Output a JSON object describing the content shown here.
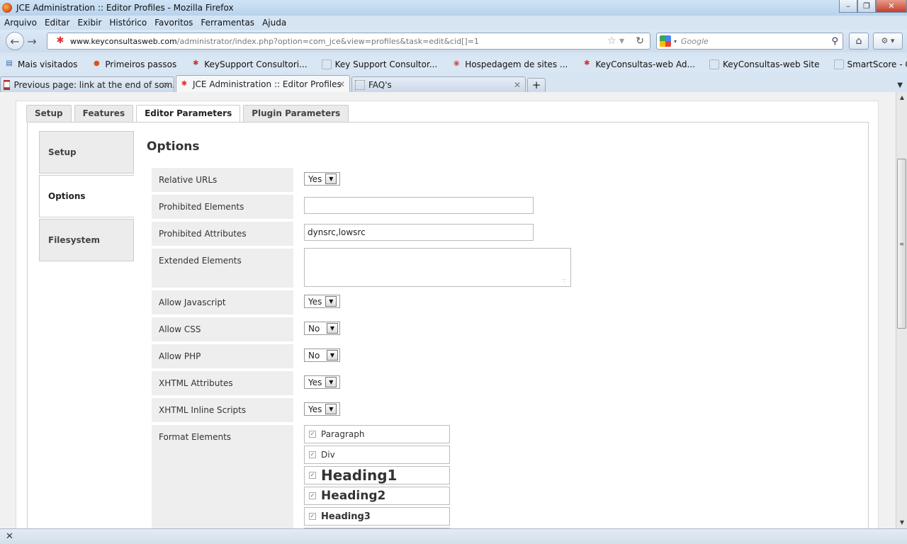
{
  "window": {
    "title": "JCE Administration :: Editor Profiles - Mozilla Firefox"
  },
  "menu": [
    "Arquivo",
    "Editar",
    "Exibir",
    "Histórico",
    "Favoritos",
    "Ferramentas",
    "Ajuda"
  ],
  "nav": {
    "url_domain": "www.keyconsultasweb.com",
    "url_path": "/administrator/index.php?option=com_jce&view=profiles&task=edit&cid[]=1",
    "search_placeholder": "Google"
  },
  "bookmarks": [
    "Mais visitados",
    "Primeiros passos",
    "KeySupport Consultori...",
    "Key Support Consultor...",
    "Hospedagem de sites ...",
    "KeyConsultas-web Ad...",
    "KeyConsultas-web Site",
    "SmartScore - Consulta..."
  ],
  "browser_tabs": [
    {
      "label": "Previous page: link at the end of som...",
      "active": false
    },
    {
      "label": "JCE Administration :: Editor Profiles",
      "active": true
    },
    {
      "label": "FAQ's",
      "active": false
    }
  ],
  "page_tabs": [
    "Setup",
    "Features",
    "Editor Parameters",
    "Plugin Parameters"
  ],
  "active_page_tab": "Editor Parameters",
  "side_tabs": [
    "Setup",
    "Options",
    "Filesystem"
  ],
  "active_side_tab": "Options",
  "section_title": "Options",
  "fields": {
    "relative_urls": {
      "label": "Relative URLs",
      "value": "Yes"
    },
    "prohibited_elements": {
      "label": "Prohibited Elements",
      "value": ""
    },
    "prohibited_attributes": {
      "label": "Prohibited Attributes",
      "value": "dynsrc,lowsrc"
    },
    "extended_elements": {
      "label": "Extended Elements",
      "value": ""
    },
    "allow_javascript": {
      "label": "Allow Javascript",
      "value": "Yes"
    },
    "allow_css": {
      "label": "Allow CSS",
      "value": "No"
    },
    "allow_php": {
      "label": "Allow PHP",
      "value": "No"
    },
    "xhtml_attributes": {
      "label": "XHTML Attributes",
      "value": "Yes"
    },
    "xhtml_inline_scripts": {
      "label": "XHTML Inline Scripts",
      "value": "Yes"
    },
    "format_elements": {
      "label": "Format Elements"
    }
  },
  "format_items": [
    {
      "label": "Paragraph",
      "checked": true
    },
    {
      "label": "Div",
      "checked": true
    },
    {
      "label": "Heading1",
      "checked": true
    },
    {
      "label": "Heading2",
      "checked": true
    },
    {
      "label": "Heading3",
      "checked": true
    }
  ]
}
